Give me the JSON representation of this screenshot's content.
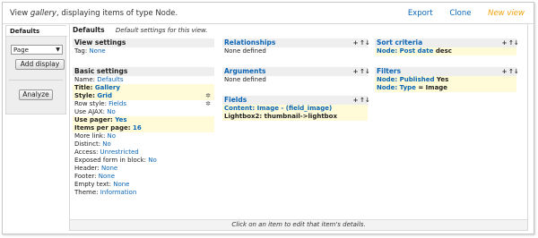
{
  "header": {
    "title_prefix": "View ",
    "title_view": "gallery",
    "title_suffix": ", displaying items of type Node.",
    "links": {
      "export": "Export",
      "clone": "Clone",
      "new_view": "New view"
    }
  },
  "left": {
    "tab_label": "Defaults",
    "select_value": "Page",
    "add_display": "Add display",
    "analyze": "Analyze"
  },
  "main": {
    "title": "Defaults",
    "description": "Default settings for this view.",
    "footer": "Click on an item to edit that item's details."
  },
  "view_settings": {
    "title": "View settings",
    "tag_label": "Tag: ",
    "tag_value": "None"
  },
  "basic_settings": {
    "title": "Basic settings",
    "rows": [
      {
        "label": "Name: ",
        "value": "Defaults"
      },
      {
        "label": "Title: ",
        "value": "Gallery"
      },
      {
        "label": "Style: ",
        "value": "Grid"
      },
      {
        "label": "Row style: ",
        "value": "Fields"
      },
      {
        "label": "Use AJAX: ",
        "value": "No"
      },
      {
        "label": "Use pager: ",
        "value": "Yes"
      },
      {
        "label": "Items per page: ",
        "value": "16"
      },
      {
        "label": "More link: ",
        "value": "No"
      },
      {
        "label": "Distinct: ",
        "value": "No"
      },
      {
        "label": "Access: ",
        "value": "Unrestricted"
      },
      {
        "label": "Exposed form in block: ",
        "value": "No"
      },
      {
        "label": "Header: ",
        "value": "None"
      },
      {
        "label": "Footer: ",
        "value": "None"
      },
      {
        "label": "Empty text: ",
        "value": "None"
      },
      {
        "label": "Theme: ",
        "value": "Information"
      }
    ]
  },
  "relationships": {
    "title": "Relationships",
    "empty": "None defined"
  },
  "arguments": {
    "title": "Arguments",
    "empty": "None defined"
  },
  "fields": {
    "title": "Fields",
    "rows": [
      "Content: Image - (field_image)",
      "Lightbox2: thumbnail->lightbox"
    ]
  },
  "sort_criteria": {
    "title": "Sort criteria",
    "row_prefix": "Node: Post date",
    "row_suffix": " desc"
  },
  "filters": {
    "title": "Filters",
    "rows": [
      {
        "label": "Node: Published",
        "value": " Yes"
      },
      {
        "label": "Node: Type",
        "value": " = Image"
      }
    ]
  },
  "icons": {
    "add": "+",
    "rearrange": "↑↓",
    "settings": "✲"
  }
}
